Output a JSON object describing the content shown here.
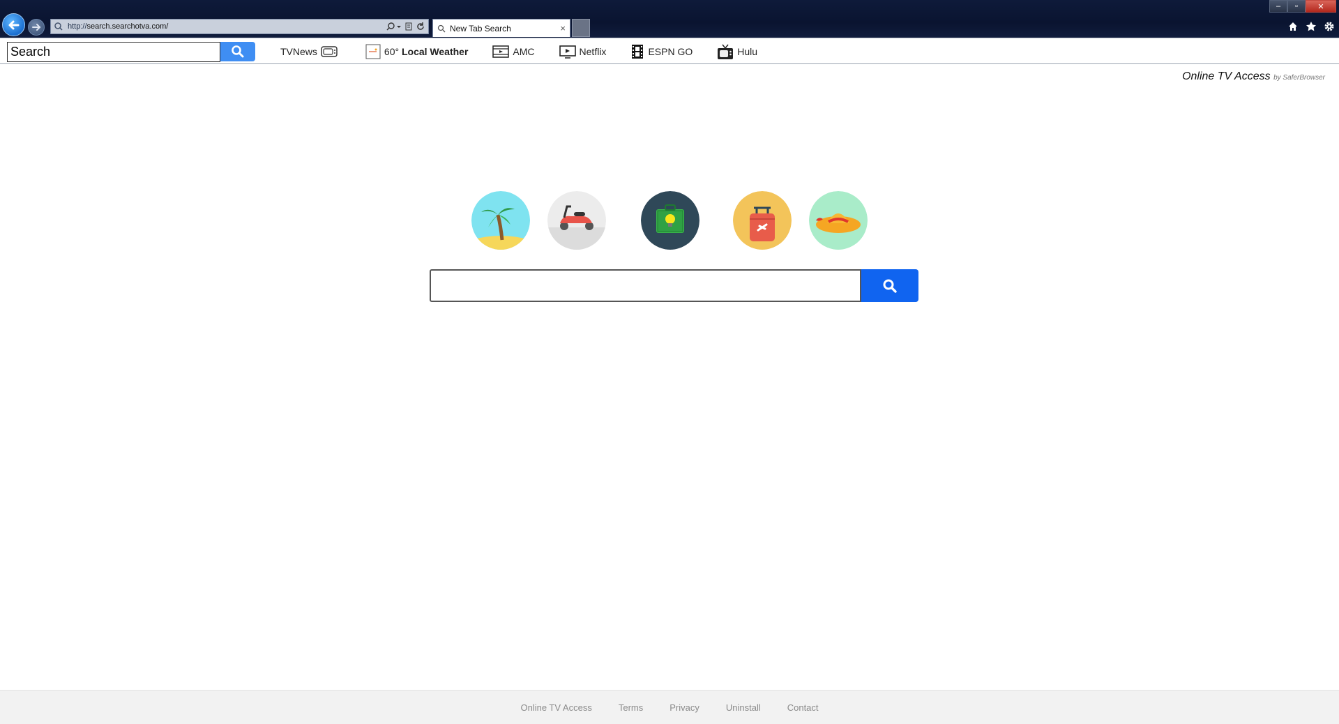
{
  "browser": {
    "address": {
      "prefix": "http://",
      "host": "search.searchotva.com/"
    },
    "tab": {
      "title": "New Tab Search",
      "close": "×"
    },
    "window_controls": {
      "minimize": "–",
      "maximize": "▫",
      "close": "✕"
    }
  },
  "toolbar": {
    "search_value": "Search",
    "links": [
      {
        "label": "TVNews",
        "icon": "tv-icon"
      },
      {
        "label_prefix": "60°",
        "label": "Local Weather",
        "icon": "weather-icon"
      },
      {
        "label": "AMC",
        "icon": "film-icon"
      },
      {
        "label": "Netflix",
        "icon": "play-screen-icon"
      },
      {
        "label": "ESPN GO",
        "icon": "filmstrip-icon"
      },
      {
        "label": "Hulu",
        "icon": "retro-tv-icon"
      }
    ]
  },
  "brand": {
    "name": "Online TV Access",
    "by": "by SaferBrowser"
  },
  "decor_icons": [
    "palm-tree-icon",
    "scooter-icon",
    "suitcase-bulb-icon",
    "luggage-icon",
    "sun-hat-icon"
  ],
  "main_search": {
    "value": "",
    "placeholder": ""
  },
  "footer": {
    "links": [
      "Online TV Access",
      "Terms",
      "Privacy",
      "Uninstall",
      "Contact"
    ]
  },
  "colors": {
    "toolbar_search_button": "#3f8ef3",
    "main_search_button": "#1064f0",
    "titlebar": "#0e1a3a"
  }
}
